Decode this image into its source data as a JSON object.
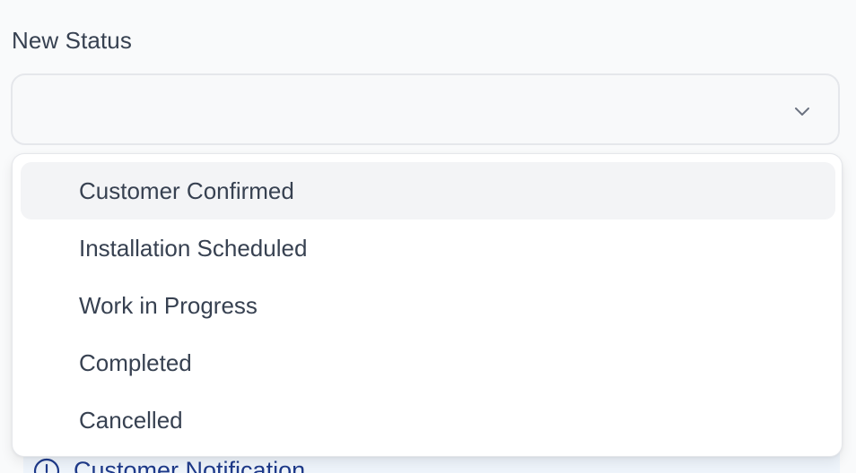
{
  "field": {
    "label": "New Status",
    "selected_value": "",
    "chevron_icon": "chevron-down-icon"
  },
  "dropdown": {
    "highlighted_index": 0,
    "options": [
      {
        "label": "Customer Confirmed"
      },
      {
        "label": "Installation Scheduled"
      },
      {
        "label": "Work in Progress"
      },
      {
        "label": "Completed"
      },
      {
        "label": "Cancelled"
      }
    ]
  },
  "notification": {
    "icon": "info-icon",
    "title": "Customer Notification"
  },
  "colors": {
    "background": "#f9fafb",
    "option_highlight": "#f3f4f6",
    "text": "#374151",
    "notification_text": "#1e3a8a",
    "notification_bg": "#eef4fb"
  }
}
